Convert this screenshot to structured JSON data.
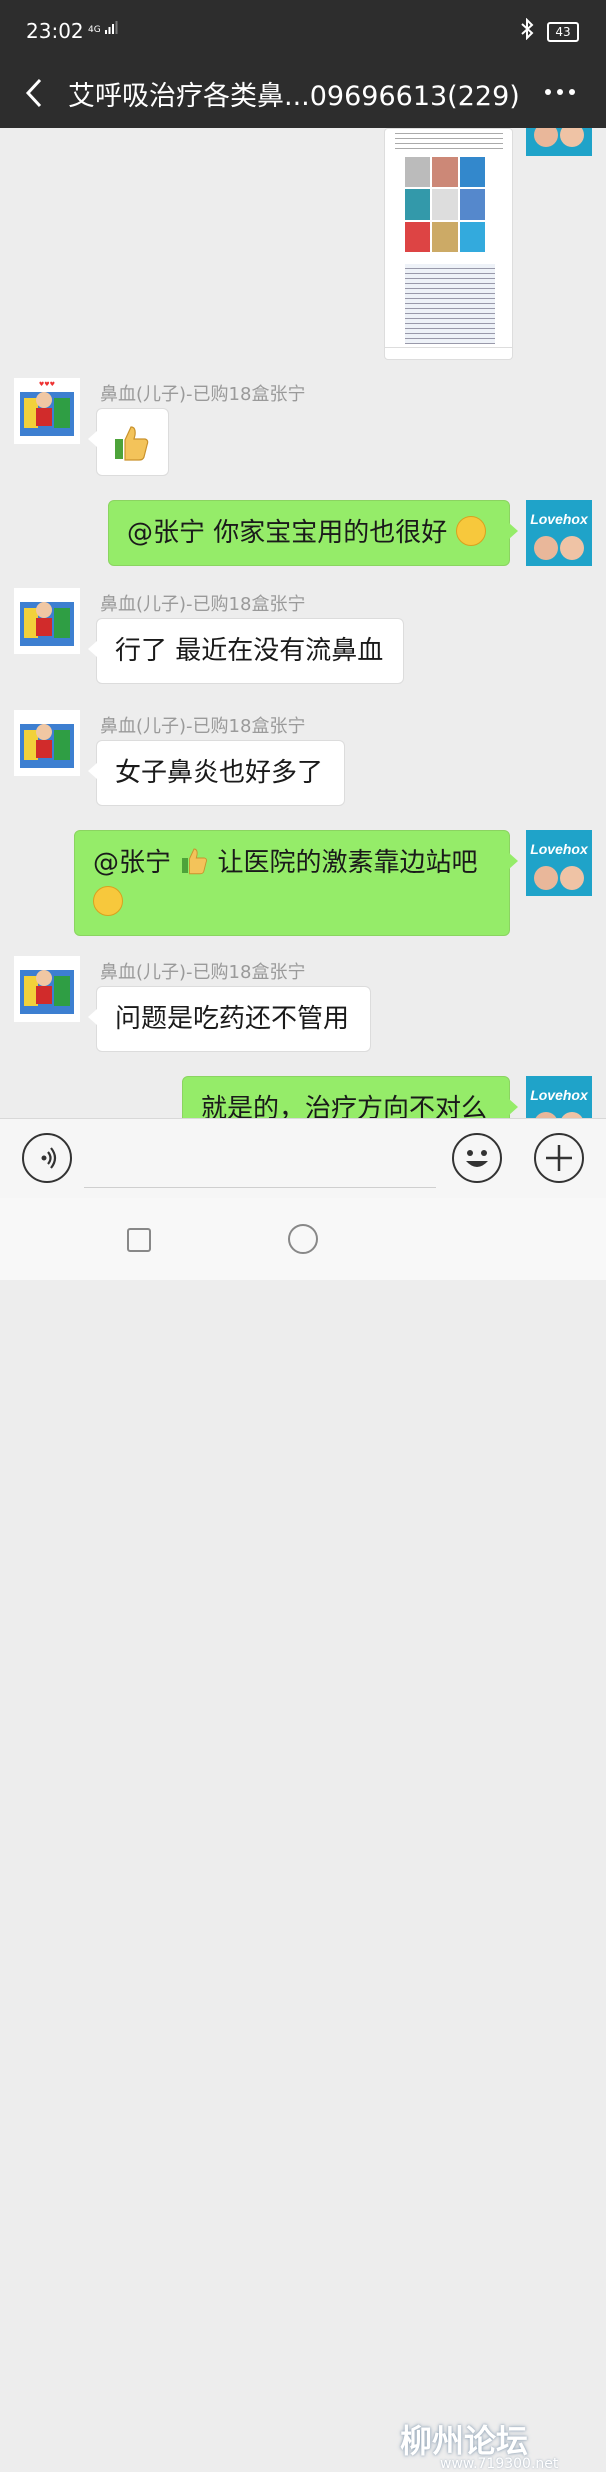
{
  "status_bar": {
    "time": "23:02",
    "network": "4G",
    "battery": "43"
  },
  "header": {
    "title": "艾呼吸治疗各类鼻...09696613(229)",
    "back_icon": "chevron-left-icon",
    "more_icon": "more-dots-icon"
  },
  "messages": [
    {
      "side": "right",
      "type": "image"
    },
    {
      "side": "left",
      "sender": "鼻血(儿子)-已购18盒张宁",
      "type": "emoji",
      "emoji": "thumbs-up"
    },
    {
      "side": "right",
      "text": "@张宁  你家宝宝用的也很好"
    },
    {
      "side": "left",
      "sender": "鼻血(儿子)-已购18盒张宁",
      "text": "行了 最近在没有流鼻血"
    },
    {
      "side": "left",
      "sender": "鼻血(儿子)-已购18盒张宁",
      "text": "女子鼻炎也好多了"
    },
    {
      "side": "right",
      "text_a": "@张宁 ",
      "text_b": "让医院的激素靠边站吧"
    },
    {
      "side": "left",
      "sender": "鼻血(儿子)-已购18盒张宁",
      "text": "问题是吃药还不管用"
    },
    {
      "side": "right",
      "text": "就是的，治疗方向不对么"
    }
  ],
  "avatar_brand": "Lovehox",
  "input_bar": {
    "voice_icon": "voice-icon",
    "emoji_icon": "emoji-icon",
    "plus_icon": "plus-icon"
  },
  "watermark": {
    "text": "柳州论坛",
    "url": "www.719300.net"
  }
}
